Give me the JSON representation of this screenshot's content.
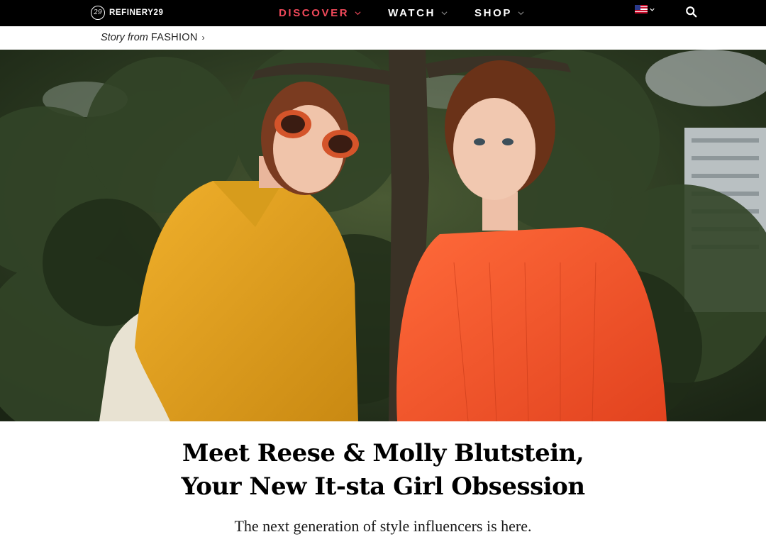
{
  "nav": {
    "logo_text": "REFINERY29",
    "links": [
      {
        "label": "DISCOVER",
        "active": true
      },
      {
        "label": "WATCH",
        "active": false
      },
      {
        "label": "SHOP",
        "active": false
      }
    ],
    "accent_color": "#f0495a",
    "icons": [
      "refinery29-logo-icon",
      "chevron-down-icon",
      "us-flag-icon",
      "search-icon"
    ]
  },
  "story": {
    "prefix": "Story from",
    "category": "FASHION",
    "arrow": "›"
  },
  "article": {
    "headline_line1": "Meet Reese & Molly Blutstein,",
    "headline_line2": "Your New It-sta Girl Obsession",
    "dek": "The next generation of style influencers is here."
  }
}
